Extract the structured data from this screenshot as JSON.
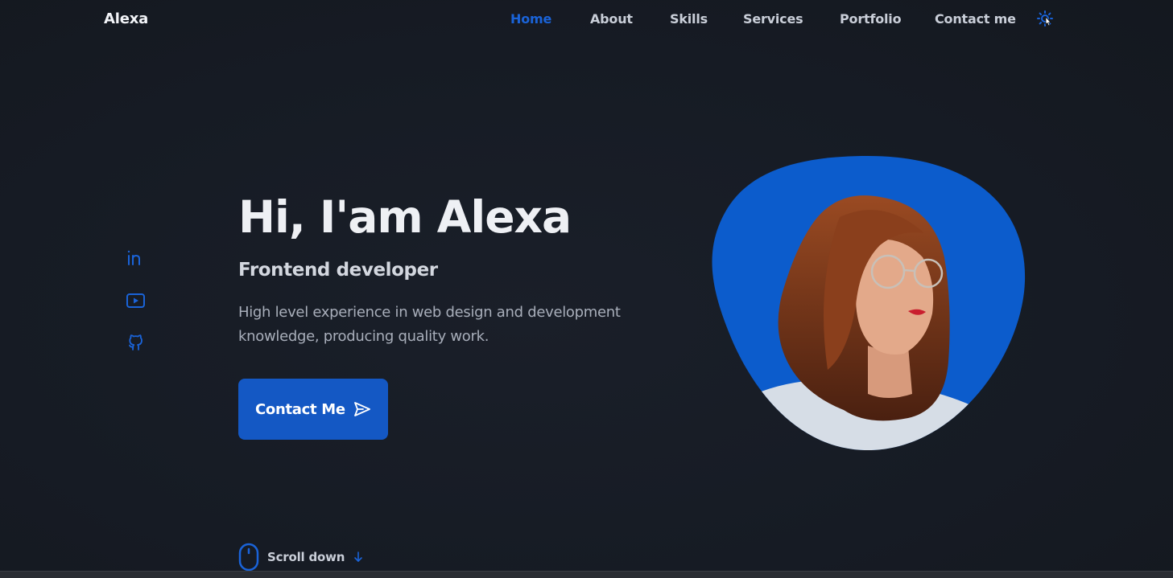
{
  "brand": {
    "name": "Alexa"
  },
  "nav": {
    "items": [
      {
        "label": "Home",
        "active": true
      },
      {
        "label": "About",
        "active": false
      },
      {
        "label": "Skills",
        "active": false
      },
      {
        "label": "Services",
        "active": false
      },
      {
        "label": "Portfolio",
        "active": false
      },
      {
        "label": "Contact me",
        "active": false
      }
    ],
    "theme_toggle_icon": "sun-icon"
  },
  "socials": [
    {
      "icon": "linkedin-icon"
    },
    {
      "icon": "youtube-icon"
    },
    {
      "icon": "github-icon"
    }
  ],
  "hero": {
    "title": "Hi, I'am Alexa",
    "subtitle": "Frontend developer",
    "description": "High level experience in web design and development knowledge, producing quality work.",
    "cta_label": "Contact Me",
    "cta_icon": "send-icon",
    "image_icon": "profile-photo"
  },
  "scroll": {
    "label": "Scroll down",
    "icon": "mouse-icon",
    "arrow_icon": "arrow-down-icon"
  },
  "colors": {
    "background": "#161b24",
    "accent": "#1458c4",
    "nav_active": "#1a63d8",
    "text": "#e9ecf2"
  }
}
